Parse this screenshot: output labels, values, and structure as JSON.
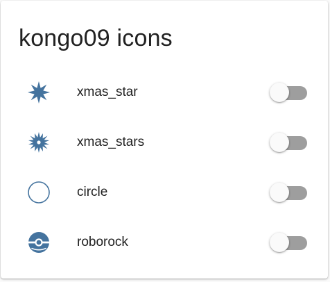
{
  "card": {
    "title": "kongo09 icons"
  },
  "colors": {
    "icon": "#44739e",
    "track": "#9e9e9e",
    "thumb": "#fafafa"
  },
  "entities": [
    {
      "name": "xmas_star",
      "icon": "xmas-star-icon",
      "state": "off"
    },
    {
      "name": "xmas_stars",
      "icon": "xmas-stars-icon",
      "state": "off"
    },
    {
      "name": "circle",
      "icon": "circle-icon",
      "state": "off"
    },
    {
      "name": "roborock",
      "icon": "roborock-icon",
      "state": "off"
    }
  ]
}
